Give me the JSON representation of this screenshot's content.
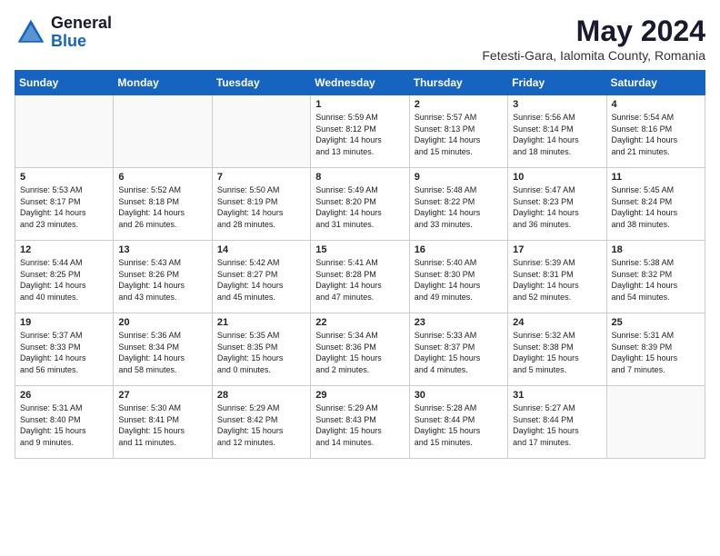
{
  "header": {
    "logo_general": "General",
    "logo_blue": "Blue",
    "month_year": "May 2024",
    "location": "Fetesti-Gara, Ialomita County, Romania"
  },
  "days_of_week": [
    "Sunday",
    "Monday",
    "Tuesday",
    "Wednesday",
    "Thursday",
    "Friday",
    "Saturday"
  ],
  "weeks": [
    [
      {
        "num": "",
        "info": "",
        "empty": true
      },
      {
        "num": "",
        "info": "",
        "empty": true
      },
      {
        "num": "",
        "info": "",
        "empty": true
      },
      {
        "num": "1",
        "info": "Sunrise: 5:59 AM\nSunset: 8:12 PM\nDaylight: 14 hours\nand 13 minutes.",
        "empty": false
      },
      {
        "num": "2",
        "info": "Sunrise: 5:57 AM\nSunset: 8:13 PM\nDaylight: 14 hours\nand 15 minutes.",
        "empty": false
      },
      {
        "num": "3",
        "info": "Sunrise: 5:56 AM\nSunset: 8:14 PM\nDaylight: 14 hours\nand 18 minutes.",
        "empty": false
      },
      {
        "num": "4",
        "info": "Sunrise: 5:54 AM\nSunset: 8:16 PM\nDaylight: 14 hours\nand 21 minutes.",
        "empty": false
      }
    ],
    [
      {
        "num": "5",
        "info": "Sunrise: 5:53 AM\nSunset: 8:17 PM\nDaylight: 14 hours\nand 23 minutes.",
        "empty": false
      },
      {
        "num": "6",
        "info": "Sunrise: 5:52 AM\nSunset: 8:18 PM\nDaylight: 14 hours\nand 26 minutes.",
        "empty": false
      },
      {
        "num": "7",
        "info": "Sunrise: 5:50 AM\nSunset: 8:19 PM\nDaylight: 14 hours\nand 28 minutes.",
        "empty": false
      },
      {
        "num": "8",
        "info": "Sunrise: 5:49 AM\nSunset: 8:20 PM\nDaylight: 14 hours\nand 31 minutes.",
        "empty": false
      },
      {
        "num": "9",
        "info": "Sunrise: 5:48 AM\nSunset: 8:22 PM\nDaylight: 14 hours\nand 33 minutes.",
        "empty": false
      },
      {
        "num": "10",
        "info": "Sunrise: 5:47 AM\nSunset: 8:23 PM\nDaylight: 14 hours\nand 36 minutes.",
        "empty": false
      },
      {
        "num": "11",
        "info": "Sunrise: 5:45 AM\nSunset: 8:24 PM\nDaylight: 14 hours\nand 38 minutes.",
        "empty": false
      }
    ],
    [
      {
        "num": "12",
        "info": "Sunrise: 5:44 AM\nSunset: 8:25 PM\nDaylight: 14 hours\nand 40 minutes.",
        "empty": false
      },
      {
        "num": "13",
        "info": "Sunrise: 5:43 AM\nSunset: 8:26 PM\nDaylight: 14 hours\nand 43 minutes.",
        "empty": false
      },
      {
        "num": "14",
        "info": "Sunrise: 5:42 AM\nSunset: 8:27 PM\nDaylight: 14 hours\nand 45 minutes.",
        "empty": false
      },
      {
        "num": "15",
        "info": "Sunrise: 5:41 AM\nSunset: 8:28 PM\nDaylight: 14 hours\nand 47 minutes.",
        "empty": false
      },
      {
        "num": "16",
        "info": "Sunrise: 5:40 AM\nSunset: 8:30 PM\nDaylight: 14 hours\nand 49 minutes.",
        "empty": false
      },
      {
        "num": "17",
        "info": "Sunrise: 5:39 AM\nSunset: 8:31 PM\nDaylight: 14 hours\nand 52 minutes.",
        "empty": false
      },
      {
        "num": "18",
        "info": "Sunrise: 5:38 AM\nSunset: 8:32 PM\nDaylight: 14 hours\nand 54 minutes.",
        "empty": false
      }
    ],
    [
      {
        "num": "19",
        "info": "Sunrise: 5:37 AM\nSunset: 8:33 PM\nDaylight: 14 hours\nand 56 minutes.",
        "empty": false
      },
      {
        "num": "20",
        "info": "Sunrise: 5:36 AM\nSunset: 8:34 PM\nDaylight: 14 hours\nand 58 minutes.",
        "empty": false
      },
      {
        "num": "21",
        "info": "Sunrise: 5:35 AM\nSunset: 8:35 PM\nDaylight: 15 hours\nand 0 minutes.",
        "empty": false
      },
      {
        "num": "22",
        "info": "Sunrise: 5:34 AM\nSunset: 8:36 PM\nDaylight: 15 hours\nand 2 minutes.",
        "empty": false
      },
      {
        "num": "23",
        "info": "Sunrise: 5:33 AM\nSunset: 8:37 PM\nDaylight: 15 hours\nand 4 minutes.",
        "empty": false
      },
      {
        "num": "24",
        "info": "Sunrise: 5:32 AM\nSunset: 8:38 PM\nDaylight: 15 hours\nand 5 minutes.",
        "empty": false
      },
      {
        "num": "25",
        "info": "Sunrise: 5:31 AM\nSunset: 8:39 PM\nDaylight: 15 hours\nand 7 minutes.",
        "empty": false
      }
    ],
    [
      {
        "num": "26",
        "info": "Sunrise: 5:31 AM\nSunset: 8:40 PM\nDaylight: 15 hours\nand 9 minutes.",
        "empty": false
      },
      {
        "num": "27",
        "info": "Sunrise: 5:30 AM\nSunset: 8:41 PM\nDaylight: 15 hours\nand 11 minutes.",
        "empty": false
      },
      {
        "num": "28",
        "info": "Sunrise: 5:29 AM\nSunset: 8:42 PM\nDaylight: 15 hours\nand 12 minutes.",
        "empty": false
      },
      {
        "num": "29",
        "info": "Sunrise: 5:29 AM\nSunset: 8:43 PM\nDaylight: 15 hours\nand 14 minutes.",
        "empty": false
      },
      {
        "num": "30",
        "info": "Sunrise: 5:28 AM\nSunset: 8:44 PM\nDaylight: 15 hours\nand 15 minutes.",
        "empty": false
      },
      {
        "num": "31",
        "info": "Sunrise: 5:27 AM\nSunset: 8:44 PM\nDaylight: 15 hours\nand 17 minutes.",
        "empty": false
      },
      {
        "num": "",
        "info": "",
        "empty": true
      }
    ]
  ]
}
